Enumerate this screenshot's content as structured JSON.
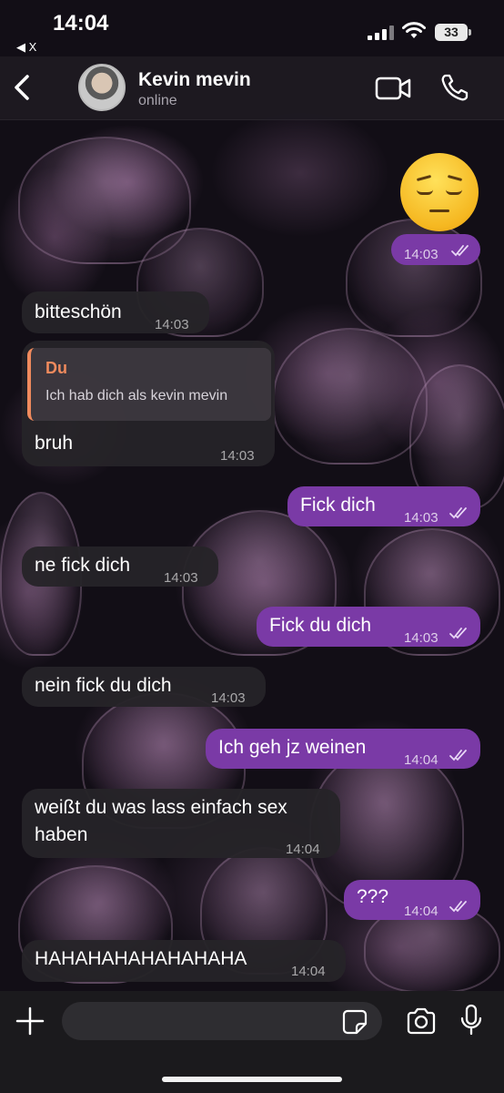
{
  "status_bar": {
    "time": "14:04",
    "back_app": "◀ X",
    "battery": "33"
  },
  "header": {
    "contact_name": "Kevin mevin",
    "contact_status": "online"
  },
  "messages": [
    {
      "dir": "out",
      "type": "emoji",
      "text": "😔",
      "time": "14:03",
      "read": true
    },
    {
      "dir": "in",
      "text": "bitteschön",
      "time": "14:03"
    },
    {
      "dir": "in",
      "reply_to_name": "Du",
      "reply_to_text": "Ich hab dich als kevin mevin",
      "text": "bruh",
      "time": "14:03"
    },
    {
      "dir": "out",
      "text": "Fick dich",
      "time": "14:03",
      "read": true
    },
    {
      "dir": "in",
      "text": "ne fick dich",
      "time": "14:03"
    },
    {
      "dir": "out",
      "text": "Fick du dich",
      "time": "14:03",
      "read": true
    },
    {
      "dir": "in",
      "text": "nein fick du dich",
      "time": "14:03"
    },
    {
      "dir": "out",
      "text": "Ich geh jz weinen",
      "time": "14:04",
      "read": true
    },
    {
      "dir": "in",
      "text_line1": "weißt du was lass einfach sex",
      "text_line2": "haben",
      "time": "14:04"
    },
    {
      "dir": "out",
      "text": "???",
      "time": "14:04",
      "read": true
    },
    {
      "dir": "in",
      "text": "HAHAHAHAHAHAHAHA",
      "time": "14:04"
    }
  ],
  "input": {
    "value": "",
    "placeholder": ""
  },
  "colors": {
    "outgoing_bubble": "#7a3aa6",
    "incoming_bubble": "#262428",
    "reply_accent": "#f08a5d"
  },
  "icons": [
    "back-icon",
    "video-call-icon",
    "phone-icon",
    "read-checks-icon",
    "plus-icon",
    "sticker-icon",
    "camera-icon",
    "microphone-icon"
  ]
}
